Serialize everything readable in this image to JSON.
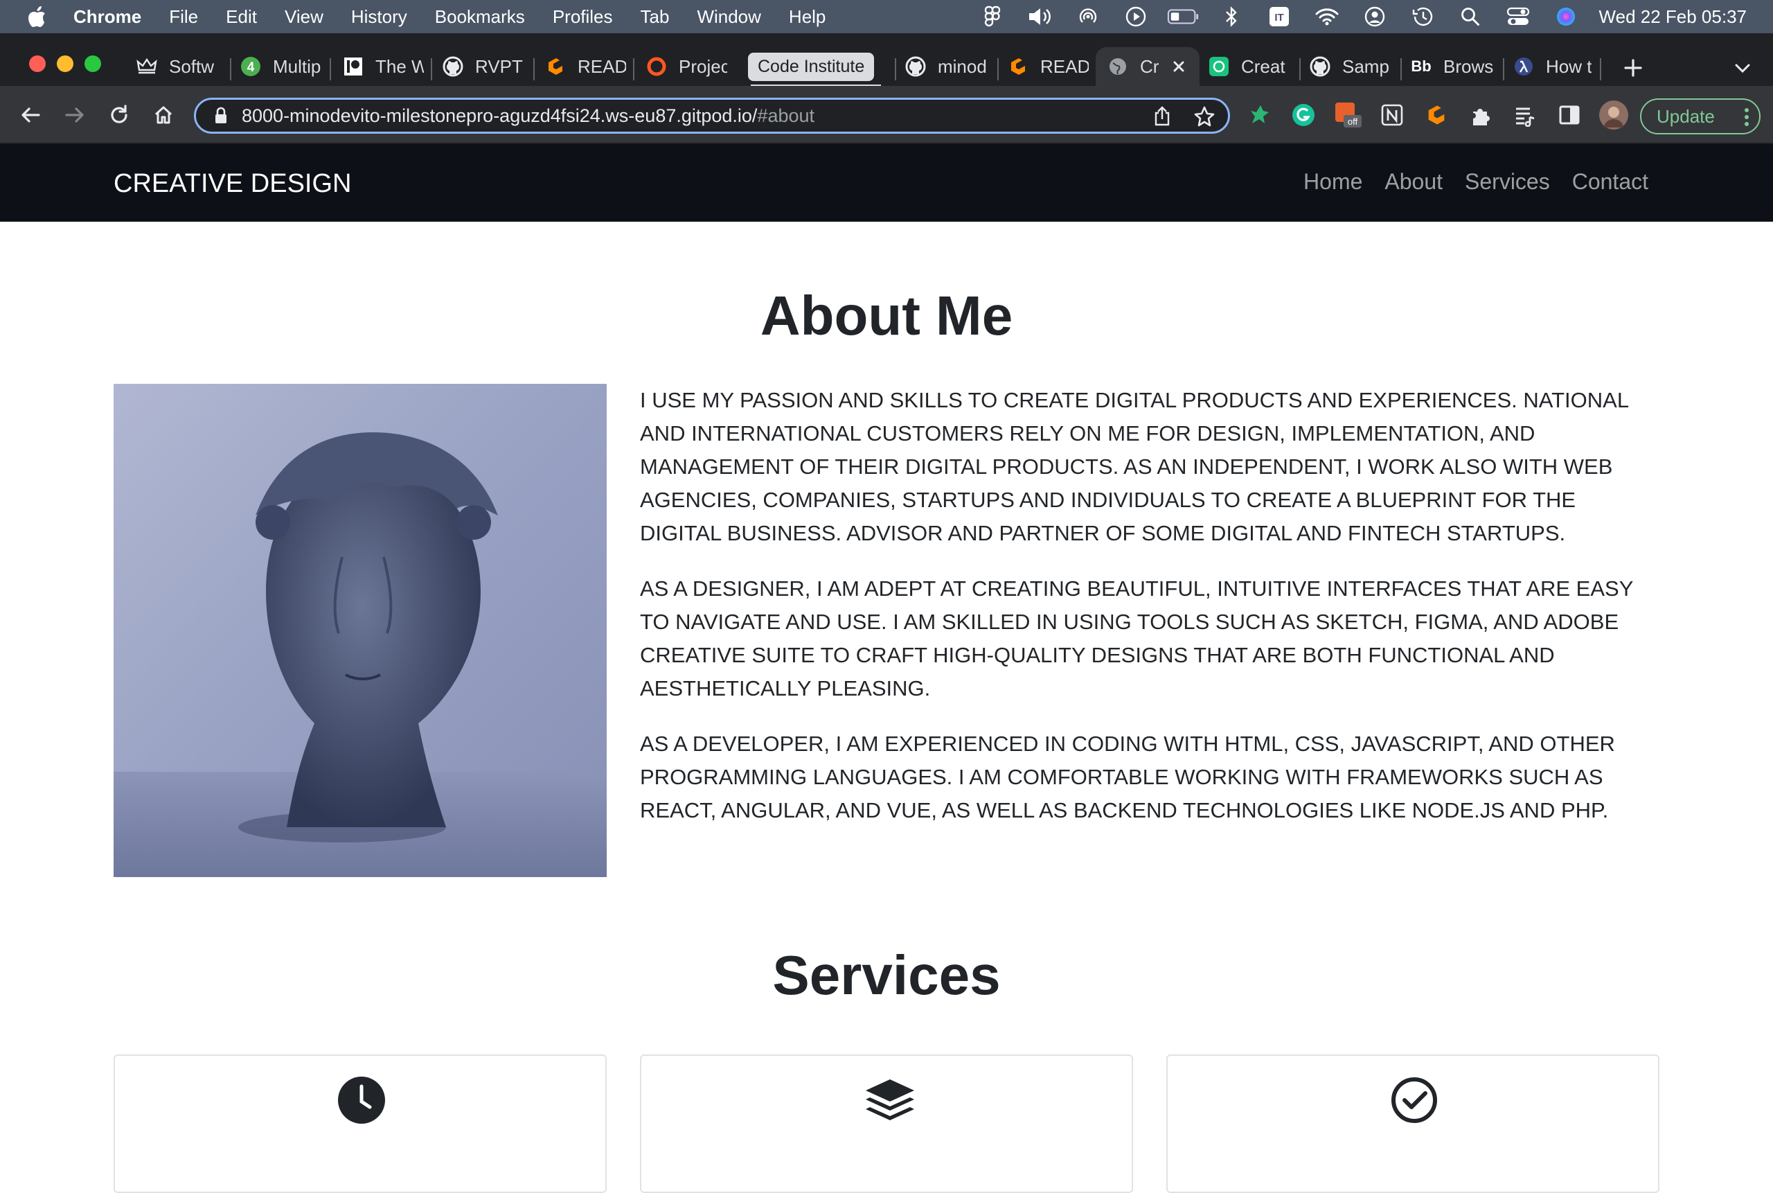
{
  "menubar": {
    "app_name": "Chrome",
    "items": [
      "File",
      "Edit",
      "View",
      "History",
      "Bookmarks",
      "Profiles",
      "Tab",
      "Window",
      "Help"
    ],
    "clock": "Wed 22 Feb  05:37"
  },
  "tabs": [
    {
      "label": "Softw",
      "icon": "crown-icon"
    },
    {
      "label": "Multip",
      "icon": "green-4-icon"
    },
    {
      "label": "The W",
      "icon": "patreon-icon"
    },
    {
      "label": "RVPT",
      "icon": "github-icon"
    },
    {
      "label": "READ",
      "icon": "gitpod-icon"
    },
    {
      "label": "Projec",
      "icon": "ring-icon"
    },
    {
      "label": "Code Institute",
      "icon": "none"
    },
    {
      "label": "minod",
      "icon": "github-icon"
    },
    {
      "label": "READ",
      "icon": "gitpod-icon"
    },
    {
      "label": "Cr",
      "icon": "globe-icon"
    },
    {
      "label": "Creat",
      "icon": "chatgpt-icon"
    },
    {
      "label": "Samp",
      "icon": "github-icon"
    },
    {
      "label": "Brows",
      "icon": "bb-icon"
    },
    {
      "label": "How t",
      "icon": "lambda-icon"
    }
  ],
  "tab_bb_text": "Bb",
  "address_bar": {
    "url_main": "8000-minodevito-milestonepro-aguzd4fsi24.ws-eu87.gitpod.io/",
    "url_hash": "#about"
  },
  "extension_off_badge": "off",
  "update_button": "Update",
  "site": {
    "brand": "CREATIVE DESIGN",
    "nav": [
      "Home",
      "About",
      "Services",
      "Contact"
    ],
    "about_title": "About Me",
    "about_paragraphs": [
      "I USE MY PASSION AND SKILLS TO CREATE DIGITAL PRODUCTS AND EXPERIENCES. NATIONAL AND INTERNATIONAL CUSTOMERS RELY ON ME FOR DESIGN, IMPLEMENTATION, AND MANAGEMENT OF THEIR DIGITAL PRODUCTS. AS AN INDEPENDENT, I WORK ALSO WITH WEB AGENCIES, COMPANIES, STARTUPS AND INDIVIDUALS TO CREATE A BLUEPRINT FOR THE DIGITAL BUSINESS. ADVISOR AND PARTNER OF SOME DIGITAL AND FINTECH STARTUPS.",
      "AS A DESIGNER, I AM ADEPT AT CREATING BEAUTIFUL, INTUITIVE INTERFACES THAT ARE EASY TO NAVIGATE AND USE. I AM SKILLED IN USING TOOLS SUCH AS SKETCH, FIGMA, AND ADOBE CREATIVE SUITE TO CRAFT HIGH-QUALITY DESIGNS THAT ARE BOTH FUNCTIONAL AND AESTHETICALLY PLEASING.",
      "AS A DEVELOPER, I AM EXPERIENCED IN CODING WITH HTML, CSS, JAVASCRIPT, AND OTHER PROGRAMMING LANGUAGES. I AM COMFORTABLE WORKING WITH FRAMEWORKS SUCH AS REACT, ANGULAR, AND VUE, AS WELL AS BACKEND TECHNOLOGIES LIKE NODE.JS AND PHP."
    ],
    "services_title": "Services",
    "service_card_icons": [
      "clock-icon",
      "layers-icon",
      "check-circle-icon"
    ]
  },
  "colors": {
    "navbar_bg": "#0d1117",
    "omnibox_focus": "#8ab4f8",
    "update_green": "#81c995",
    "heading": "#212529"
  }
}
